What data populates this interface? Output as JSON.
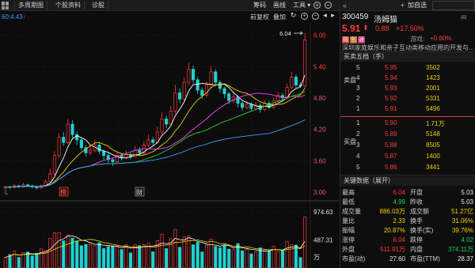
{
  "toolbar": {
    "multi_period": "多周期图",
    "stock_info": "个股资料",
    "diagnose": "诊股",
    "chips": "筹码",
    "drawing": "画线",
    "tools": "工具",
    "add_watch": "加自选"
  },
  "subbar": {
    "ma_label": "60:4.43",
    "adjust": "前复权",
    "overlay": "叠加"
  },
  "stock": {
    "code": "300459",
    "name": "汤姆猫",
    "price": "5.91",
    "change": "0.88",
    "change_pct": "+17.50%",
    "tags": [
      "融",
      "创",
      "通"
    ],
    "sector_label": "游戏:",
    "sector_pct": "+0.60%",
    "description": "深圳家庭娱乐和亲子互动类移动应用的开发与..."
  },
  "orderbook": {
    "title": "买卖五档（手）",
    "sell_side_label": "卖盘",
    "buy_side_label": "买盘",
    "sell": [
      {
        "level": "5",
        "price": "5.95",
        "vol": "3502"
      },
      {
        "level": "4",
        "price": "5.94",
        "vol": "1423"
      },
      {
        "level": "3",
        "price": "5.93",
        "vol": "2001"
      },
      {
        "level": "2",
        "price": "5.92",
        "vol": "5331"
      },
      {
        "level": "1",
        "price": "5.91",
        "vol": "5496"
      }
    ],
    "buy": [
      {
        "level": "1",
        "price": "5.90",
        "vol": "1.71万"
      },
      {
        "level": "2",
        "price": "5.89",
        "vol": "5148"
      },
      {
        "level": "3",
        "price": "5.88",
        "vol": "8505"
      },
      {
        "level": "4",
        "price": "5.87",
        "vol": "1400"
      },
      {
        "level": "5",
        "price": "5.86",
        "vol": "3441"
      }
    ]
  },
  "keydata": {
    "title": "关键数据（展开）",
    "rows": [
      [
        {
          "k": "最高",
          "v": "6.04",
          "c": "red"
        },
        {
          "k": "开盘",
          "v": "5.03",
          "c": "white"
        }
      ],
      [
        {
          "k": "最低",
          "v": "4.99",
          "c": "green"
        },
        {
          "k": "昨收",
          "v": "5.03",
          "c": "white"
        }
      ],
      [
        {
          "k": "成交量",
          "v": "886.03万",
          "c": "yellow"
        },
        {
          "k": "成交额",
          "v": "51.27亿",
          "c": "yellow"
        }
      ],
      [
        {
          "k": "量比",
          "v": "2.33",
          "c": "yellow"
        },
        {
          "k": "换手",
          "v": "31.06%",
          "c": "yellow"
        }
      ],
      [
        {
          "k": "振幅",
          "v": "20.87%",
          "c": "yellow"
        },
        {
          "k": "换手(实)",
          "v": "39.76%",
          "c": "yellow"
        }
      ],
      [
        {
          "k": "涨停",
          "v": "6.04",
          "c": "red"
        },
        {
          "k": "跌停",
          "v": "4.02",
          "c": "green"
        }
      ],
      [
        {
          "k": "外盘",
          "v": "511.91万",
          "c": "red"
        },
        {
          "k": "内盘",
          "v": "374.11万",
          "c": "green"
        }
      ],
      [
        {
          "k": "市盈(动)",
          "v": "27.60",
          "c": "white"
        },
        {
          "k": "市盈(TTM)",
          "v": "28.37",
          "c": "white"
        }
      ]
    ]
  },
  "chart_labels": {
    "high_mark": "6.04",
    "price_ticks": [
      "6.00",
      "5.40",
      "4.80",
      "4.20",
      "3.60",
      "3.00"
    ],
    "vol_ticks": [
      "974.63",
      "487.31"
    ],
    "vol_unit": "万",
    "event_l": "L",
    "event_a": "榜",
    "event_b": "财"
  },
  "colors": {
    "up": "#ff3b3b",
    "down": "#1fd1d1",
    "ma5": "#ffffff",
    "ma10": "#f0d000",
    "ma20": "#ff40ff",
    "ma30": "#2fd02f",
    "ma60": "#3fa0ff"
  },
  "chart_data": {
    "type": "candlestick",
    "ylim": [
      3.0,
      6.1
    ],
    "candles": [
      [
        3.08,
        3.1,
        3.05,
        3.12
      ],
      [
        3.1,
        3.09,
        3.06,
        3.13
      ],
      [
        3.09,
        3.12,
        3.07,
        3.15
      ],
      [
        3.12,
        3.1,
        3.08,
        3.14
      ],
      [
        3.1,
        3.14,
        3.09,
        3.18
      ],
      [
        3.14,
        3.12,
        3.1,
        3.16
      ],
      [
        3.12,
        3.1,
        3.07,
        3.14
      ],
      [
        3.1,
        3.08,
        3.05,
        3.12
      ],
      [
        3.08,
        3.12,
        3.06,
        3.15
      ],
      [
        3.12,
        3.2,
        3.1,
        3.24
      ],
      [
        3.2,
        3.35,
        3.18,
        3.45
      ],
      [
        3.35,
        3.7,
        3.32,
        3.78
      ],
      [
        3.7,
        4.05,
        3.66,
        4.12
      ],
      [
        4.05,
        3.95,
        3.88,
        4.15
      ],
      [
        3.95,
        4.3,
        3.92,
        4.4
      ],
      [
        4.3,
        4.1,
        4.02,
        4.38
      ],
      [
        4.1,
        4.0,
        3.9,
        4.16
      ],
      [
        4.0,
        3.85,
        3.8,
        4.05
      ],
      [
        3.85,
        3.75,
        3.68,
        3.9
      ],
      [
        3.75,
        3.8,
        3.7,
        3.88
      ],
      [
        3.8,
        3.9,
        3.76,
        4.0
      ],
      [
        3.9,
        3.78,
        3.72,
        3.96
      ],
      [
        3.78,
        3.7,
        3.6,
        3.82
      ],
      [
        3.7,
        3.62,
        3.55,
        3.75
      ],
      [
        3.62,
        3.58,
        3.5,
        3.66
      ],
      [
        3.58,
        3.7,
        3.55,
        3.78
      ],
      [
        3.7,
        3.66,
        3.6,
        3.75
      ],
      [
        3.66,
        3.72,
        3.62,
        3.8
      ],
      [
        3.72,
        3.68,
        3.63,
        3.76
      ],
      [
        3.68,
        3.8,
        3.66,
        3.88
      ],
      [
        3.8,
        3.75,
        3.7,
        3.86
      ],
      [
        3.75,
        3.9,
        3.72,
        3.98
      ],
      [
        3.9,
        4.0,
        3.86,
        4.1
      ],
      [
        4.0,
        3.95,
        3.88,
        4.06
      ],
      [
        3.95,
        4.15,
        3.92,
        4.25
      ],
      [
        4.15,
        4.4,
        4.1,
        4.52
      ],
      [
        4.4,
        4.3,
        4.22,
        4.46
      ],
      [
        4.3,
        4.55,
        4.26,
        4.65
      ],
      [
        4.55,
        4.9,
        4.5,
        5.05
      ],
      [
        4.9,
        4.78,
        4.7,
        4.98
      ],
      [
        4.78,
        5.1,
        4.74,
        5.2
      ],
      [
        5.1,
        5.35,
        5.04,
        5.48
      ],
      [
        5.35,
        5.15,
        5.08,
        5.42
      ],
      [
        5.15,
        4.95,
        4.88,
        5.2
      ],
      [
        4.95,
        4.85,
        4.78,
        5.0
      ],
      [
        4.85,
        5.05,
        4.82,
        5.12
      ],
      [
        5.05,
        5.3,
        5.0,
        5.4
      ],
      [
        5.3,
        5.1,
        5.02,
        5.35
      ],
      [
        5.1,
        4.98,
        4.9,
        5.14
      ],
      [
        4.98,
        4.88,
        4.8,
        5.02
      ],
      [
        4.88,
        4.75,
        4.68,
        4.92
      ],
      [
        4.75,
        4.82,
        4.7,
        4.88
      ],
      [
        4.82,
        4.7,
        4.62,
        4.86
      ],
      [
        4.7,
        4.62,
        4.55,
        4.74
      ],
      [
        4.62,
        4.68,
        4.58,
        4.75
      ],
      [
        4.68,
        4.6,
        4.55,
        4.72
      ],
      [
        4.6,
        4.66,
        4.56,
        4.72
      ],
      [
        4.66,
        4.58,
        4.52,
        4.7
      ],
      [
        4.58,
        4.7,
        4.55,
        4.76
      ],
      [
        4.7,
        4.62,
        4.58,
        4.75
      ],
      [
        4.62,
        4.75,
        4.6,
        4.8
      ],
      [
        4.75,
        4.85,
        4.72,
        4.92
      ],
      [
        4.85,
        4.8,
        4.74,
        4.9
      ],
      [
        4.8,
        5.0,
        4.78,
        5.08
      ],
      [
        5.0,
        5.2,
        4.96,
        5.3
      ],
      [
        5.2,
        5.05,
        4.98,
        5.25
      ],
      [
        5.05,
        5.03,
        4.99,
        5.1
      ],
      [
        5.03,
        5.91,
        4.99,
        6.04
      ]
    ],
    "volume_ticks": [
      974.63,
      487.31
    ]
  }
}
